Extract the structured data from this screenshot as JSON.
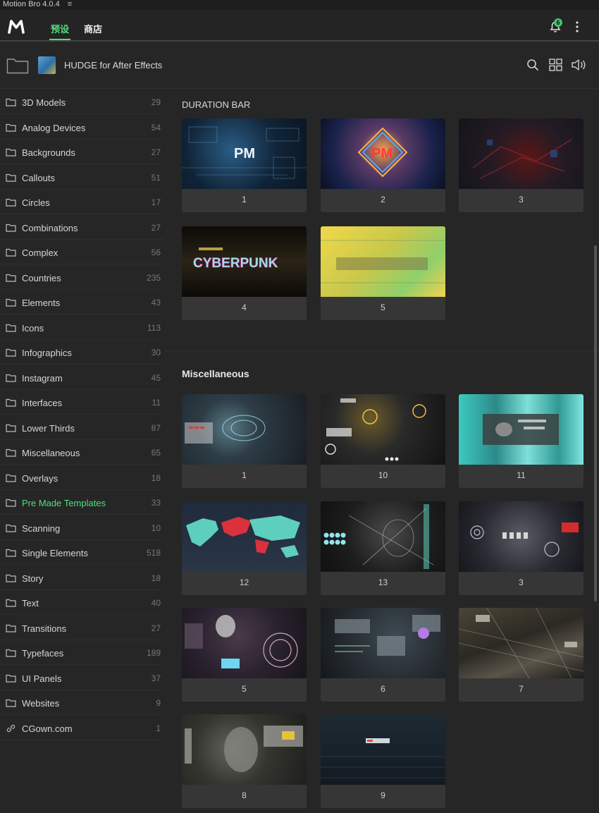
{
  "window": {
    "title": "Motion Bro 4.0.4",
    "menu_glyph": "≡"
  },
  "topbar": {
    "tabs": [
      {
        "label": "预设",
        "active": true
      },
      {
        "label": "商店",
        "active": false
      }
    ],
    "notifications_count": "6"
  },
  "pathbar": {
    "pack_name": "HUDGE for After Effects"
  },
  "sidebar": {
    "active_color": "#4ee07a",
    "items": [
      {
        "label": "3D Models",
        "count": "29"
      },
      {
        "label": "Analog Devices",
        "count": "54"
      },
      {
        "label": "Backgrounds",
        "count": "27"
      },
      {
        "label": "Callouts",
        "count": "51"
      },
      {
        "label": "Circles",
        "count": "17"
      },
      {
        "label": "Combinations",
        "count": "27"
      },
      {
        "label": "Complex",
        "count": "56"
      },
      {
        "label": "Countries",
        "count": "235"
      },
      {
        "label": "Elements",
        "count": "43"
      },
      {
        "label": "Icons",
        "count": "113"
      },
      {
        "label": "Infographics",
        "count": "30"
      },
      {
        "label": "Instagram",
        "count": "45"
      },
      {
        "label": "Interfaces",
        "count": "11"
      },
      {
        "label": "Lower Thirds",
        "count": "87"
      },
      {
        "label": "Miscellaneous",
        "count": "65"
      },
      {
        "label": "Overlays",
        "count": "18"
      },
      {
        "label": "Pre Made Templates",
        "count": "33",
        "active": true
      },
      {
        "label": "Scanning",
        "count": "10"
      },
      {
        "label": "Single Elements",
        "count": "518"
      },
      {
        "label": "Story",
        "count": "18"
      },
      {
        "label": "Text",
        "count": "40"
      },
      {
        "label": "Transitions",
        "count": "27"
      },
      {
        "label": "Typefaces",
        "count": "189"
      },
      {
        "label": "UI Panels",
        "count": "37"
      },
      {
        "label": "Websites",
        "count": "9"
      },
      {
        "label": "CGown.com",
        "count": "1",
        "icon": "link-icon"
      }
    ]
  },
  "sections": [
    {
      "title": "DURATION BAR",
      "cards": [
        {
          "label": "1",
          "thumb_text": "PM"
        },
        {
          "label": "2",
          "thumb_text": "PM"
        },
        {
          "label": "3"
        },
        {
          "label": "4",
          "thumb_text": "CYBERPUNK"
        },
        {
          "label": "5"
        }
      ]
    },
    {
      "title": "Miscellaneous",
      "cards": [
        {
          "label": "1"
        },
        {
          "label": "10"
        },
        {
          "label": "11"
        },
        {
          "label": "12"
        },
        {
          "label": "13"
        },
        {
          "label": "3"
        },
        {
          "label": "5"
        },
        {
          "label": "6"
        },
        {
          "label": "7"
        },
        {
          "label": "8"
        },
        {
          "label": "9"
        }
      ]
    }
  ]
}
